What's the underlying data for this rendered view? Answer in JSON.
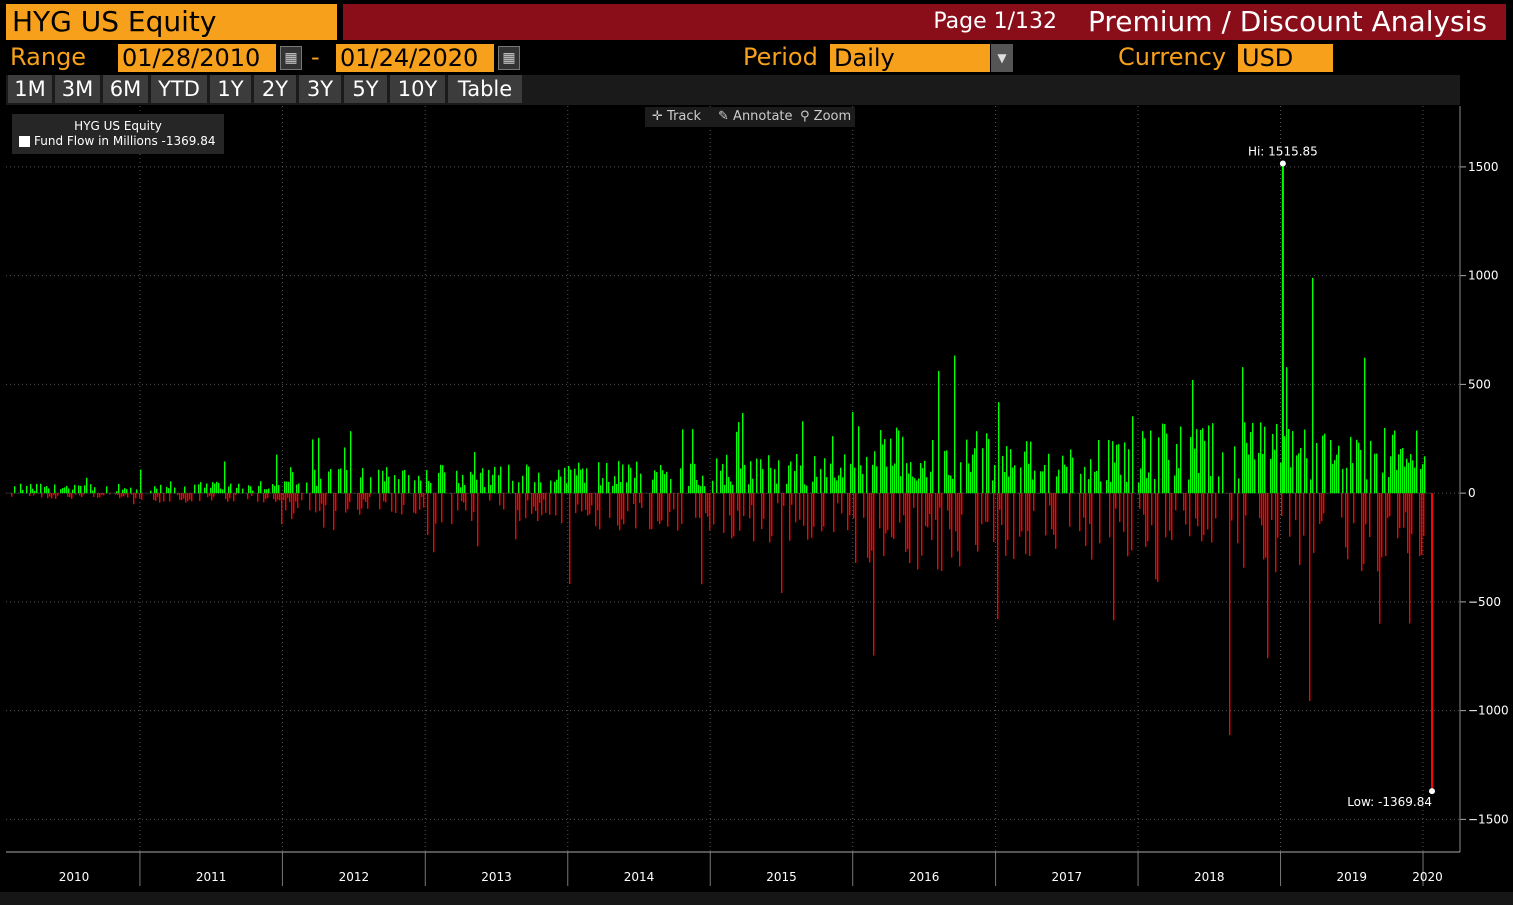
{
  "header": {
    "ticker": "HYG US Equity",
    "page": "Page 1/132",
    "function_title": "Premium / Discount Analysis"
  },
  "controls": {
    "range_label": "Range",
    "start_date": "01/28/2010",
    "date_separator": "-",
    "end_date": "01/24/2020",
    "period_label": "Period",
    "period_value": "Daily",
    "currency_label": "Currency",
    "currency_value": "USD"
  },
  "tabs": [
    "1M",
    "3M",
    "6M",
    "YTD",
    "1Y",
    "2Y",
    "3Y",
    "5Y",
    "10Y",
    "Table"
  ],
  "tools": {
    "track": "Track",
    "annotate": "Annotate",
    "zoom": "Zoom"
  },
  "legend": {
    "security": "HYG US Equity",
    "series_label": "Fund Flow in Millions -1369.84"
  },
  "colors": {
    "accent": "#f7a01c",
    "title_bar": "#8a0d1a",
    "positive": "#00ff00",
    "negative": "#ff0000",
    "grid": "#555555"
  },
  "chart_data": {
    "type": "bar",
    "series": [
      {
        "name": "Fund Flow in Millions"
      }
    ],
    "ylim": [
      -1650,
      1780
    ],
    "yticks": [
      1500,
      1000,
      500,
      0,
      -500,
      -1000,
      -1500
    ],
    "x_range": [
      "2010-01-28",
      "2020-01-24"
    ],
    "year_labels": [
      "2010",
      "2011",
      "2012",
      "2013",
      "2014",
      "2015",
      "2016",
      "2017",
      "2018",
      "2019",
      "2020"
    ],
    "hi": {
      "label": "Hi: 1515.85",
      "value": 1515.85,
      "date": "2019-01-07"
    },
    "low": {
      "label": "Low: -1369.84",
      "value": -1369.84,
      "date": "2020-01-24"
    },
    "periods": [
      {
        "year": 2010,
        "pos_typical": 40,
        "pos_peak": 100,
        "neg_typical": 25,
        "neg_peak": 80
      },
      {
        "year": 2011,
        "pos_typical": 50,
        "pos_peak": 180,
        "neg_typical": 40,
        "neg_peak": 180
      },
      {
        "year": 2012,
        "pos_typical": 110,
        "pos_peak": 300,
        "neg_typical": 90,
        "neg_peak": 210
      },
      {
        "year": 2013,
        "pos_typical": 120,
        "pos_peak": 300,
        "neg_typical": 130,
        "neg_peak": 320
      },
      {
        "year": 2014,
        "pos_typical": 140,
        "pos_peak": 340,
        "neg_typical": 160,
        "neg_peak": 630
      },
      {
        "year": 2015,
        "pos_typical": 170,
        "pos_peak": 450,
        "neg_typical": 210,
        "neg_peak": 560
      },
      {
        "year": 2016,
        "pos_typical": 280,
        "pos_peak": 700,
        "neg_typical": 330,
        "neg_peak": 990
      },
      {
        "year": 2017,
        "pos_typical": 230,
        "pos_peak": 560,
        "neg_typical": 280,
        "neg_peak": 780
      },
      {
        "year": 2018,
        "pos_typical": 300,
        "pos_peak": 790,
        "neg_typical": 380,
        "neg_peak": 1220
      },
      {
        "year": 2019,
        "pos_typical": 280,
        "pos_peak": 1040,
        "neg_typical": 330,
        "neg_peak": 990
      },
      {
        "year": 2020,
        "pos_typical": 200,
        "pos_peak": 370,
        "neg_typical": 200,
        "neg_peak": 300
      }
    ]
  }
}
